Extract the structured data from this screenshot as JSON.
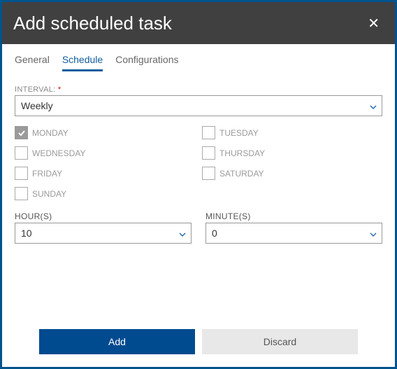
{
  "title": "Add scheduled task",
  "tabs": {
    "general": "General",
    "schedule": "Schedule",
    "configurations": "Configurations",
    "active": "schedule"
  },
  "interval": {
    "label": "INTERVAL:",
    "value": "Weekly"
  },
  "days": {
    "monday": {
      "label": "MONDAY",
      "checked": true
    },
    "tuesday": {
      "label": "TUESDAY",
      "checked": false
    },
    "wednesday": {
      "label": "WEDNESDAY",
      "checked": false
    },
    "thursday": {
      "label": "THURSDAY",
      "checked": false
    },
    "friday": {
      "label": "FRIDAY",
      "checked": false
    },
    "saturday": {
      "label": "SATURDAY",
      "checked": false
    },
    "sunday": {
      "label": "SUNDAY",
      "checked": false
    }
  },
  "hours": {
    "label": "HOUR(S)",
    "value": "10"
  },
  "minutes": {
    "label": "MINUTE(S)",
    "value": "0"
  },
  "buttons": {
    "add": "Add",
    "discard": "Discard"
  }
}
